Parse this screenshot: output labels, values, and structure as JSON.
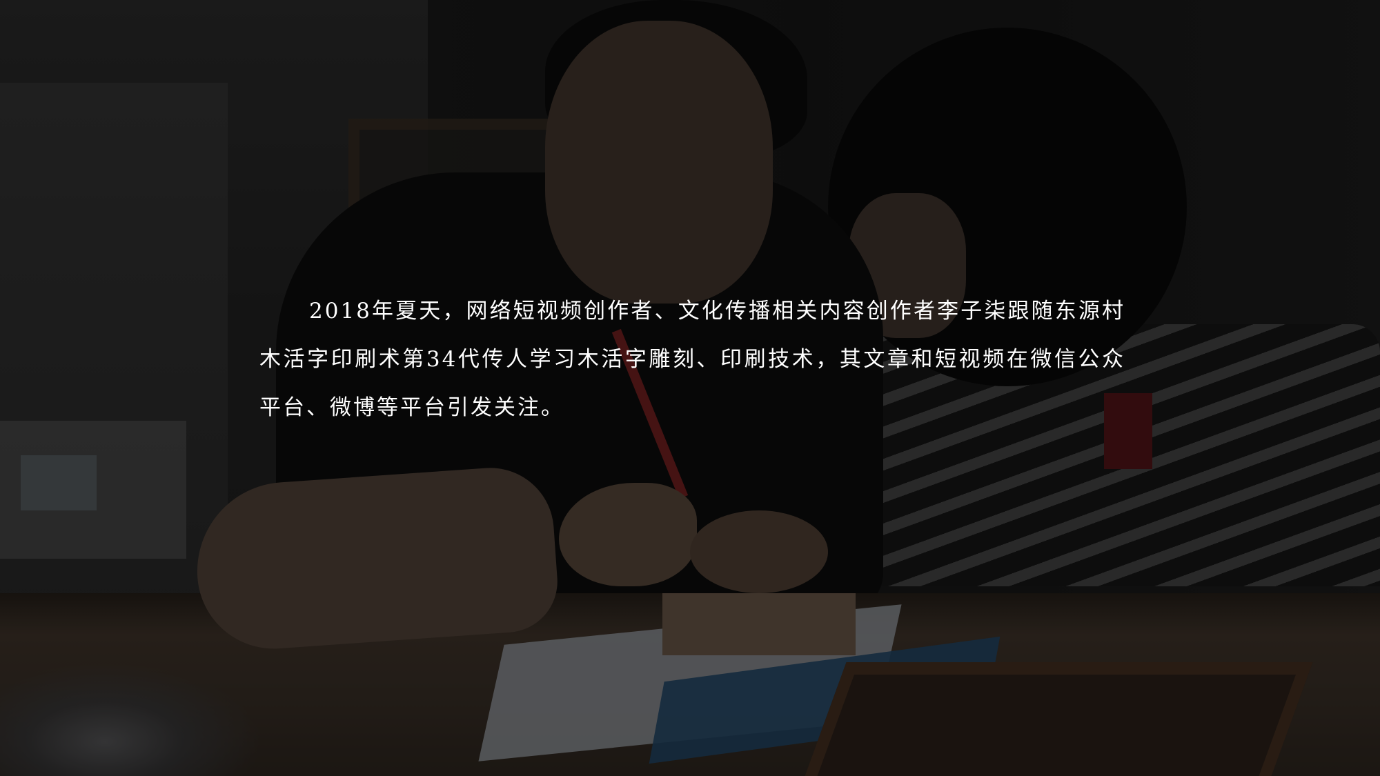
{
  "caption": {
    "text": "2018年夏天，网络短视频创作者、文化传播相关内容创作者李子柒跟随东源村木活字印刷术第34代传人学习木活字雕刻、印刷技术，其文章和短视频在微信公众平台、微博等平台引发关注。"
  },
  "background_photo": {
    "depiction": "two-people-carving-wooden-type"
  },
  "colors": {
    "text": "#ffffff",
    "overlay": "rgba(0,0,0,0.55)"
  }
}
